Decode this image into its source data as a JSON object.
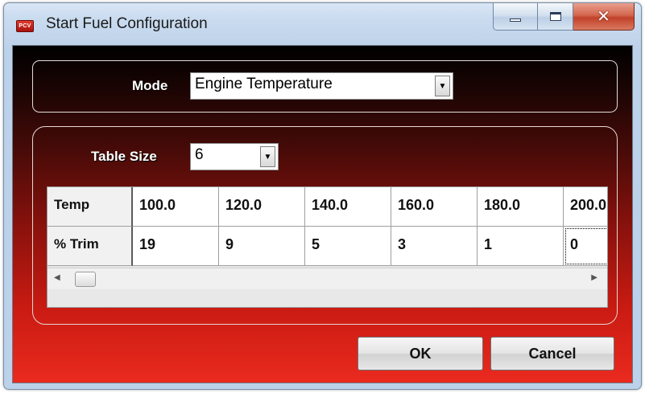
{
  "window": {
    "icon_text": "PCV",
    "title": "Start Fuel Configuration"
  },
  "mode": {
    "label": "Mode",
    "selected": "Engine Temperature"
  },
  "table_size": {
    "label": "Table Size",
    "selected": "6"
  },
  "grid": {
    "rows": [
      {
        "header": "Temp",
        "cells": [
          "100.0",
          "120.0",
          "140.0",
          "160.0",
          "180.0",
          "200.0"
        ]
      },
      {
        "header": "% Trim",
        "cells": [
          "19",
          "9",
          "5",
          "3",
          "1",
          "0"
        ]
      }
    ]
  },
  "buttons": {
    "ok": "OK",
    "cancel": "Cancel"
  },
  "colors": {
    "gradient_top": "#000000",
    "gradient_bottom": "#ea2a1f",
    "close_button": "#c2412a"
  },
  "icons": [
    "minimize-icon",
    "maximize-icon",
    "close-icon",
    "dropdown-arrow-icon",
    "scroll-left-icon",
    "scroll-right-icon"
  ]
}
